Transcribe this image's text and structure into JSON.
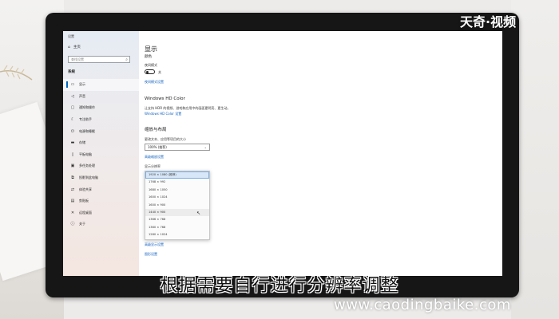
{
  "window": {
    "title": "设置"
  },
  "sidebar": {
    "home_label": "主页",
    "search_placeholder": "查找设置",
    "section": "系统",
    "items": [
      {
        "label": "显示",
        "icon": "monitor-icon",
        "active": true
      },
      {
        "label": "声音",
        "icon": "speaker-icon"
      },
      {
        "label": "通知和操作",
        "icon": "message-icon"
      },
      {
        "label": "专注助手",
        "icon": "moon-icon"
      },
      {
        "label": "电源和睡眠",
        "icon": "power-icon"
      },
      {
        "label": "存储",
        "icon": "drive-icon"
      },
      {
        "label": "平板电脑",
        "icon": "tablet-icon"
      },
      {
        "label": "多任务处理",
        "icon": "multitask-icon"
      },
      {
        "label": "投影到此电脑",
        "icon": "project-icon"
      },
      {
        "label": "体验共享",
        "icon": "share-icon"
      },
      {
        "label": "剪贴板",
        "icon": "clipboard-icon"
      },
      {
        "label": "远程桌面",
        "icon": "remote-icon"
      },
      {
        "label": "关于",
        "icon": "info-icon"
      }
    ]
  },
  "main": {
    "title": "显示",
    "color_heading": "颜色",
    "night_light_label": "夜间模式",
    "night_light_state": "关",
    "night_light_link": "夜间模式设置",
    "hdr_heading": "Windows HD Color",
    "hdr_desc": "让支持 HDR 的视频、游戏和应用中的画面更明亮、更生动。",
    "hdr_link": "Windows HD Color 设置",
    "scale_heading": "缩放与布局",
    "scale_label": "更改文本、应用等项目的大小",
    "scale_value": "100% (推荐)",
    "scale_link": "高级缩放设置",
    "resolution_label": "显示分辨率",
    "resolution_options": [
      "1920 × 1080 (推荐)",
      "1768 × 992",
      "1680 × 1050",
      "1600 × 1024",
      "1600 × 900",
      "1440 × 900",
      "1366 × 768",
      "1360 × 768",
      "1280 × 1024"
    ],
    "selected_index": 0,
    "hover_index": 5,
    "advanced_display_link": "高级显示设置",
    "graphics_link": "图形设置"
  },
  "caption": "根据需要自行进行分辨率调整",
  "logo": "天奇·视频",
  "watermark": "www.caodingbaike.com"
}
